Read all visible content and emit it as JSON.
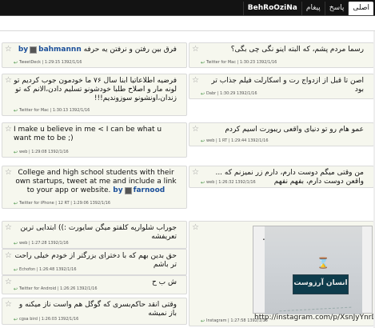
{
  "tabs": {
    "home": "اصلی",
    "reply": "پاسخ",
    "message": "پیغام",
    "brand": "BehRoOziNa"
  },
  "photo": {
    "text": "انسان آرزوست",
    "link": "http://instagram.com/p/XsnJyYnrDh"
  },
  "left": [
    {
      "text": "فرق بین رفتن و نرفتن یه حرفه",
      "user": "bahmannn",
      "meta": "TweetDeck | 1:29:15 1392/1/16"
    },
    {
      "text": "فرضیه اطلاعاتیا ابنا سال ۷۶ ما خودمون جوب کردیم تو لونه مار و اصلاح طلبا خودشونو تسلیم دادن،الانم که تو زندان،اونشونو سوزوندیم!!!",
      "meta": "Twitter for Mac | 1:30:13 1392/1/16"
    },
    {
      "text": "I make u believe in me < I can be what u want me to be ;)",
      "meta": "web | 1:29:08 1392/1/16"
    },
    {
      "text": "College and high school students with their own startups, tweet at me and include a link to your app or website.",
      "user": "farnood",
      "meta": "Twitter for iPhone | 12 RT | 1:29:06 1392/1/16"
    },
    {
      "text": "جوراب شلوارپه کلفتو میگن سایورت :)) ابتدایی ترین تعریفشه",
      "meta": "web | 1:27:28 1392/1/16"
    },
    {
      "text": "حق بدین بهم که با دخترای بزرگتر از خودم خیلی راحت تر باشم",
      "meta": "Echofon | 1:26:48 1392/1/16"
    },
    {
      "text": "ش ب ح",
      "meta": "Twitter for Android | 1:26:26 1392/1/16"
    },
    {
      "text": "وقتی انقد حاکم‌بسری که گوگل هم واست ناز میکنه و باز نمیشه",
      "meta": "cgsa bird | 1:26:03 1392/1/16"
    }
  ],
  "right": [
    {
      "text": "رسما مردم پشم، که البته اینو نگی چی بگی؟",
      "meta": "Twitter for Mac | 1:30:23 1392/1/16"
    },
    {
      "text": "اصن تا قبل از ازدواج رت و اسکارلت فیلم جذاب تر بود",
      "meta": "Dabr | 1:30:29 1392/1/16"
    },
    {
      "text": "عمو هام رو تو دنیای واقعی ریبورت اسیم کردم",
      "meta": "web | 1 RT | 1:29:44 1392/1/16"
    },
    {
      "text": "من وقتی میگم دوست دارم، دارم زر نمیزنم که ... واقعن دوست دارم، بفهم نفهم",
      "meta": "web | 1:26:32 1392/1/16"
    },
    {
      "text": "...",
      "meta": "Instagram | 1:27:58 1392/1/16"
    }
  ]
}
